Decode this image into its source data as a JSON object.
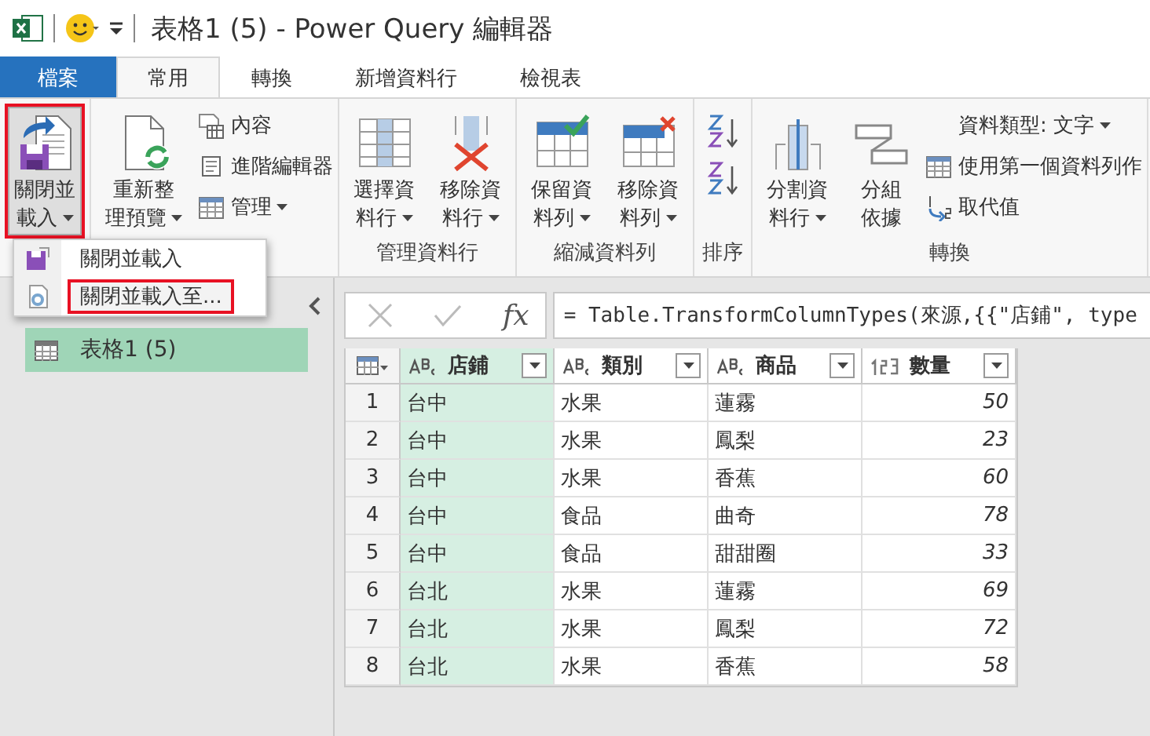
{
  "title_bar": {
    "title": "表格1 (5) - Power Query 編輯器"
  },
  "tabs": [
    {
      "label": "檔案",
      "kind": "file",
      "selected": false
    },
    {
      "label": "常用",
      "kind": "tab",
      "selected": true
    },
    {
      "label": "轉換",
      "kind": "tab",
      "selected": false
    },
    {
      "label": "新增資料行",
      "kind": "tab",
      "selected": false
    },
    {
      "label": "檢視表",
      "kind": "tab",
      "selected": false
    }
  ],
  "ribbon": {
    "groups": [
      {
        "items": [
          {
            "kind": "large",
            "lines": [
              "關閉並",
              "載入"
            ],
            "dropdown": true,
            "pressed": true,
            "highlighted": true
          }
        ]
      },
      {
        "items": [
          {
            "kind": "large",
            "lines": [
              "重新整",
              "理預覽"
            ],
            "dropdown": true,
            "pressed": false
          },
          {
            "kind": "stack",
            "entries": [
              {
                "label": "內容",
                "dropdown": false
              },
              {
                "label": "進階編輯器",
                "dropdown": false
              },
              {
                "label": "管理",
                "dropdown": true
              }
            ]
          }
        ]
      },
      {
        "label": "管理資料行",
        "items": [
          {
            "kind": "large",
            "lines": [
              "選擇資",
              "料行"
            ],
            "dropdown": true,
            "pressed": false
          },
          {
            "kind": "large",
            "lines": [
              "移除資",
              "料行"
            ],
            "dropdown": true,
            "pressed": false
          }
        ]
      },
      {
        "label": "縮減資料列",
        "items": [
          {
            "kind": "large",
            "lines": [
              "保留資",
              "料列"
            ],
            "dropdown": true,
            "pressed": false
          },
          {
            "kind": "large",
            "lines": [
              "移除資",
              "料列"
            ],
            "dropdown": true,
            "pressed": false
          }
        ]
      },
      {
        "label": "排序",
        "items": [
          {
            "kind": "sort"
          }
        ]
      },
      {
        "label": "轉換",
        "items": [
          {
            "kind": "large",
            "lines": [
              "分割資",
              "料行"
            ],
            "dropdown": true,
            "pressed": false
          },
          {
            "kind": "large",
            "lines": [
              "分組",
              "依據"
            ],
            "dropdown": false,
            "pressed": false
          },
          {
            "kind": "stack",
            "entries": [
              {
                "label": "資料類型: 文字",
                "dropdown": true
              },
              {
                "label": "使用第一個資料列作",
                "dropdown": false
              },
              {
                "label": "取代值",
                "dropdown": false
              }
            ]
          }
        ]
      }
    ]
  },
  "menu": {
    "items": [
      {
        "label": "關閉並載入",
        "selected": false,
        "highlighted": false
      },
      {
        "label": "關閉並載入至...",
        "selected": true,
        "highlighted": true
      }
    ]
  },
  "queries": {
    "items": [
      {
        "label": "表格1 (5)",
        "selected": true
      }
    ]
  },
  "formula_bar": {
    "fx": "fx",
    "formula": "= Table.TransformColumnTypes(來源,{{\"店鋪\", type"
  },
  "table": {
    "columns": [
      {
        "name": "店鋪",
        "kind": "text",
        "selected": true
      },
      {
        "name": "類別",
        "kind": "text",
        "selected": false
      },
      {
        "name": "商品",
        "kind": "text",
        "selected": false
      },
      {
        "name": "數量",
        "kind": "number",
        "selected": false
      }
    ],
    "rows": [
      {
        "index": "1",
        "cells": [
          "台中",
          "水果",
          "蓮霧",
          "50"
        ]
      },
      {
        "index": "2",
        "cells": [
          "台中",
          "水果",
          "鳳梨",
          "23"
        ]
      },
      {
        "index": "3",
        "cells": [
          "台中",
          "水果",
          "香蕉",
          "60"
        ]
      },
      {
        "index": "4",
        "cells": [
          "台中",
          "食品",
          "曲奇",
          "78"
        ]
      },
      {
        "index": "5",
        "cells": [
          "台中",
          "食品",
          "甜甜圈",
          "33"
        ]
      },
      {
        "index": "6",
        "cells": [
          "台北",
          "水果",
          "蓮霧",
          "69"
        ]
      },
      {
        "index": "7",
        "cells": [
          "台北",
          "水果",
          "鳳梨",
          "72"
        ]
      },
      {
        "index": "8",
        "cells": [
          "台北",
          "水果",
          "香蕉",
          "58"
        ]
      }
    ]
  }
}
